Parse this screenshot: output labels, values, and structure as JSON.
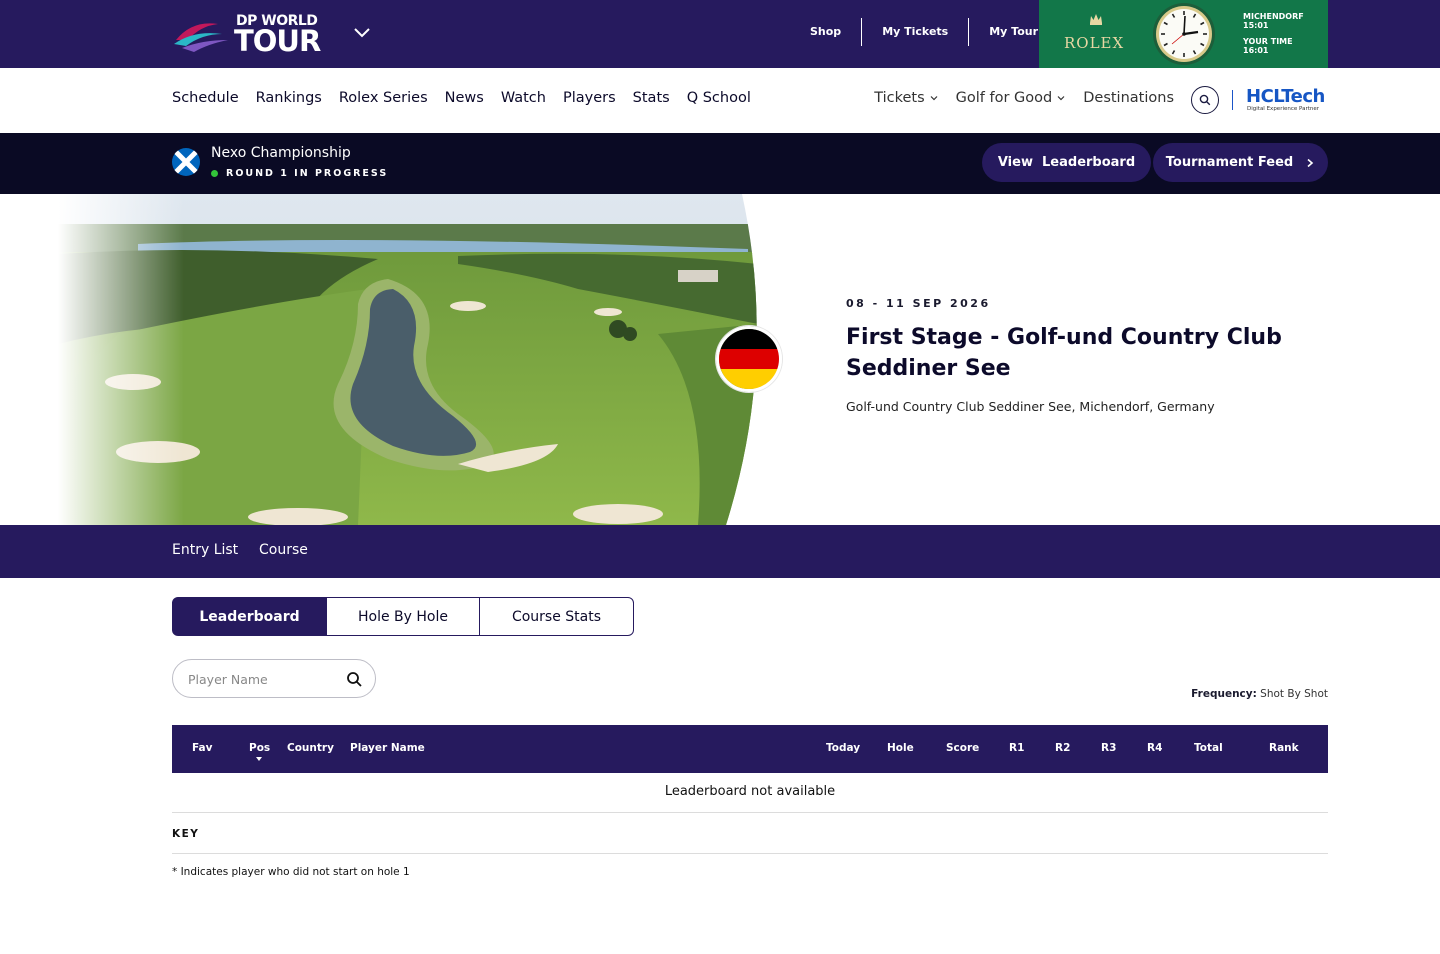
{
  "brand": {
    "logo_line1": "DP WORLD",
    "logo_line2": "TOUR",
    "primary_color": "#261a5e",
    "dark_color": "#0a0a24"
  },
  "topbar": {
    "links": [
      "Shop",
      "My Tickets",
      "My Tour"
    ]
  },
  "rolex": {
    "brand": "ROLEX",
    "location": "MICHENDORF",
    "location_time": "15:01",
    "your_time_label": "YOUR TIME",
    "your_time": "16:01",
    "bg_color": "#127749"
  },
  "nav": {
    "left": [
      "Schedule",
      "Rankings",
      "Rolex Series",
      "News",
      "Watch",
      "Players",
      "Stats",
      "Q School"
    ],
    "right": [
      {
        "label": "Tickets",
        "dropdown": true
      },
      {
        "label": "Golf for Good",
        "dropdown": true
      },
      {
        "label": "Destinations",
        "dropdown": false
      }
    ],
    "partner": "HCLTech",
    "partner_sub": "Digital Experience Partner"
  },
  "event": {
    "name": "Nexo Championship",
    "status": "ROUND 1 IN PROGRESS",
    "status_color": "#33c43a",
    "view_leaderboard": "View  Leaderboard",
    "tournament_feed": "Tournament Feed"
  },
  "hero": {
    "date": "08 - 11 SEP 2026",
    "title": "First Stage - Golf-und Country Club Seddiner See",
    "location": "Golf-und Country Club Seddiner See, Michendorf, Germany"
  },
  "subnav": [
    "Entry List",
    "Course"
  ],
  "tabs": [
    "Leaderboard",
    "Hole By Hole",
    "Course Stats"
  ],
  "search": {
    "placeholder": "Player Name"
  },
  "frequency": {
    "label": "Frequency:",
    "value": "Shot By Shot"
  },
  "table": {
    "columns": [
      "Fav",
      "Pos",
      "Country",
      "Player Name",
      "Today",
      "Hole",
      "Score",
      "R1",
      "R2",
      "R3",
      "R4",
      "Total",
      "Rank"
    ],
    "empty_message": "Leaderboard not available"
  },
  "key": {
    "heading": "KEY",
    "note": "* Indicates player who did not start on hole 1"
  }
}
